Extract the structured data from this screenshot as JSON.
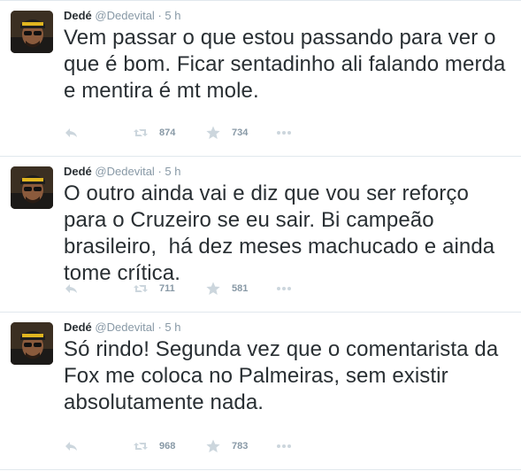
{
  "tweets": [
    {
      "name": "Dedé",
      "handle": "@Dedevital",
      "separator": "·",
      "time": "5 h",
      "text": "Vem passar o que estou passando para ver o que é bom. Ficar sentadinho ali falando merda e mentira é mt mole.",
      "retweets": "874",
      "favorites": "734"
    },
    {
      "name": "Dedé",
      "handle": "@Dedevital",
      "separator": "·",
      "time": "5 h",
      "text": "O outro ainda vai e diz que vou ser reforço para o Cruzeiro se eu sair. Bi campeão brasileiro,  há dez meses machucado e ainda tome crítica.",
      "retweets": "711",
      "favorites": "581"
    },
    {
      "name": "Dedé",
      "handle": "@Dedevital",
      "separator": "·",
      "time": "5 h",
      "text": "Só rindo! Segunda vez que o comentarista da Fox me coloca no Palmeiras, sem existir absolutamente nada.",
      "retweets": "968",
      "favorites": "783"
    }
  ],
  "icons": {
    "reply": "reply-icon",
    "retweet": "retweet-icon",
    "favorite": "star-icon",
    "more": "more-icon"
  },
  "colors": {
    "text": "#292f33",
    "muted": "#8899a6",
    "icon": "#ccd6dd",
    "divider": "#e1e8ed"
  }
}
